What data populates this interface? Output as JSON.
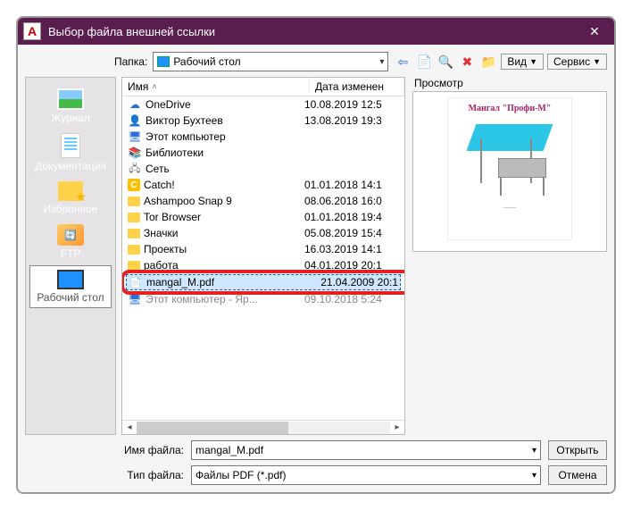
{
  "title": "Выбор файла внешней ссылки",
  "folder_label": "Папка:",
  "folder_selected": "Рабочий стол",
  "view_btn": "Вид",
  "tools_btn": "Сервис",
  "sidebar": {
    "journal": "Журнал",
    "docs": "Документация",
    "fav": "Избранное",
    "ftp": "FTP",
    "desktop": "Рабочий стол"
  },
  "headers": {
    "name": "Имя",
    "date": "Дата изменен"
  },
  "files": [
    {
      "icon": "cloud",
      "name": "OneDrive",
      "date": "10.08.2019 12:5"
    },
    {
      "icon": "user",
      "name": "Виктор Бухтеев",
      "date": "13.08.2019 19:3"
    },
    {
      "icon": "pc",
      "name": "Этот компьютер",
      "date": ""
    },
    {
      "icon": "lib",
      "name": "Библиотеки",
      "date": ""
    },
    {
      "icon": "net",
      "name": "Сеть",
      "date": ""
    },
    {
      "icon": "catch",
      "name": "Catch!",
      "date": "01.01.2018 14:1"
    },
    {
      "icon": "folder",
      "name": "Ashampoo Snap 9",
      "date": "08.06.2018 16:0"
    },
    {
      "icon": "folder",
      "name": "Tor Browser",
      "date": "01.01.2018 19:4"
    },
    {
      "icon": "folder",
      "name": "Значки",
      "date": "05.08.2019 15:4"
    },
    {
      "icon": "folder",
      "name": "Проекты",
      "date": "16.03.2019 14:1"
    },
    {
      "icon": "folder",
      "name": "работа",
      "date": "04.01.2019 20:1"
    }
  ],
  "selected_file": {
    "name": "mangal_M.pdf",
    "date": "21.04.2009 20:1"
  },
  "after_file": {
    "name": "Этот компьютер - Яр...",
    "date": "09.10.2018 5:24"
  },
  "preview_label": "Просмотр",
  "preview_title": "Мангал \"Профи-М\"",
  "filename_label": "Имя файла:",
  "filename_value": "mangal_M.pdf",
  "filetype_label": "Тип файла:",
  "filetype_value": "Файлы PDF (*.pdf)",
  "open_btn": "Открыть",
  "cancel_btn": "Отмена"
}
